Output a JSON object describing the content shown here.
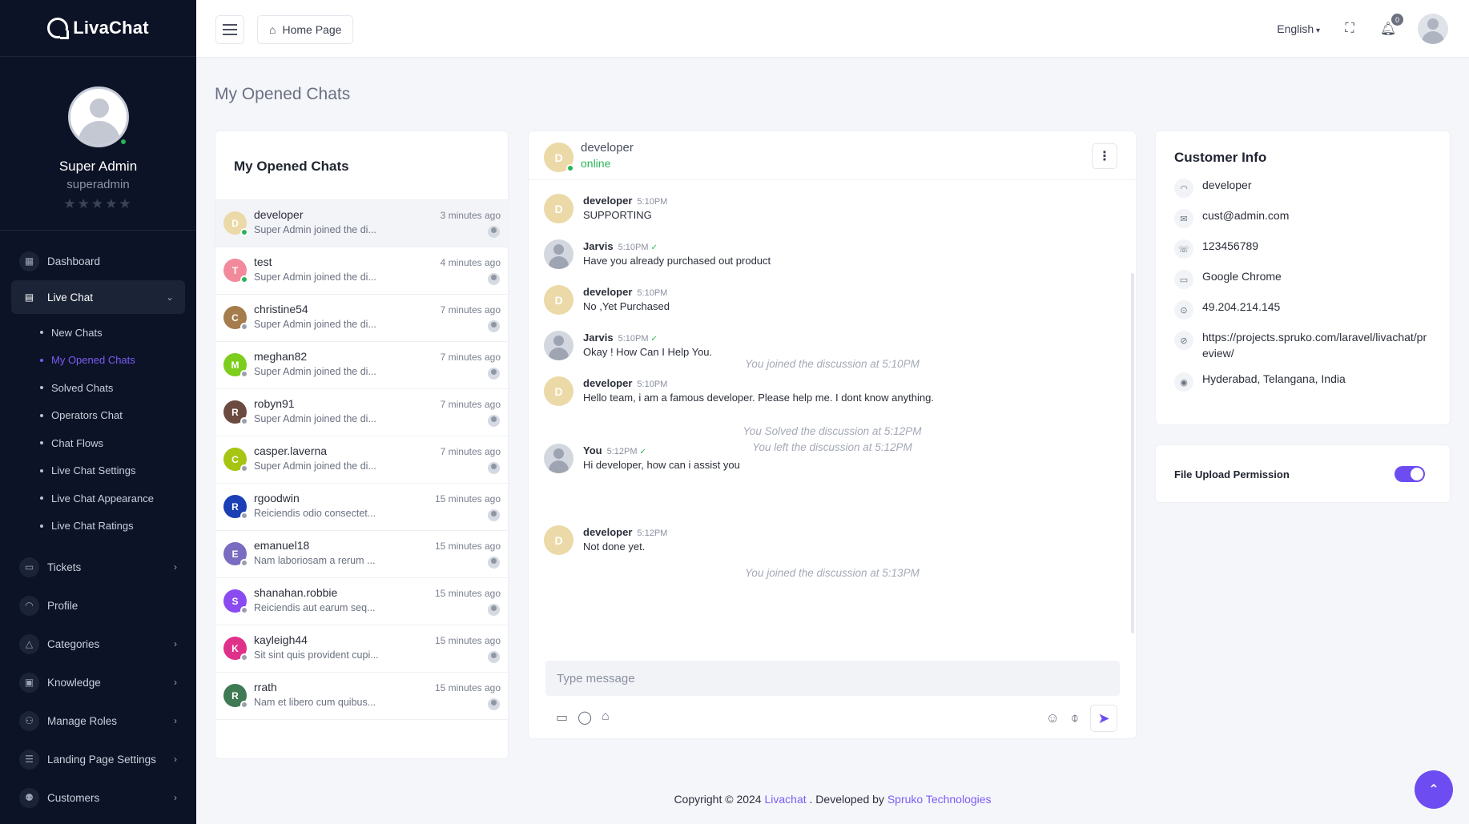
{
  "brand": {
    "name": "LivaChat"
  },
  "user": {
    "name": "Super Admin",
    "role": "superadmin",
    "stars": "★★★★★"
  },
  "nav": {
    "dashboard": "Dashboard",
    "live_chat": "Live Chat",
    "sub": [
      "New Chats",
      "My Opened Chats",
      "Solved Chats",
      "Operators Chat",
      "Chat Flows",
      "Live Chat Settings",
      "Live Chat Appearance",
      "Live Chat Ratings"
    ],
    "tickets": "Tickets",
    "profile": "Profile",
    "categories": "Categories",
    "knowledge": "Knowledge",
    "manage_roles": "Manage Roles",
    "landing": "Landing Page Settings",
    "customers": "Customers"
  },
  "header": {
    "breadcrumb": "Home Page",
    "language": "English",
    "notif_count": "0"
  },
  "page_title": "My Opened Chats",
  "chat_list": {
    "title": "My Opened Chats",
    "rows": [
      {
        "initial": "D",
        "name": "developer",
        "msg": "Super Admin joined the di...",
        "time": "3 minutes ago",
        "color": "#ebd9a8",
        "online": true
      },
      {
        "initial": "T",
        "name": "test",
        "msg": "Super Admin joined the di...",
        "time": "4 minutes ago",
        "color": "#f28a9c",
        "online": true
      },
      {
        "initial": "C",
        "name": "christine54",
        "msg": "Super Admin joined the di...",
        "time": "7 minutes ago",
        "color": "#a57c4b",
        "online": false
      },
      {
        "initial": "M",
        "name": "meghan82",
        "msg": "Super Admin joined the di...",
        "time": "7 minutes ago",
        "color": "#7ccd1c",
        "online": false
      },
      {
        "initial": "R",
        "name": "robyn91",
        "msg": "Super Admin joined the di...",
        "time": "7 minutes ago",
        "color": "#6b4a40",
        "online": false
      },
      {
        "initial": "C",
        "name": "casper.laverna",
        "msg": "Super Admin joined the di...",
        "time": "7 minutes ago",
        "color": "#a6c412",
        "online": false
      },
      {
        "initial": "R",
        "name": "rgoodwin",
        "msg": "Reiciendis odio consectet...",
        "time": "15 minutes ago",
        "color": "#1b3fb5",
        "online": false
      },
      {
        "initial": "E",
        "name": "emanuel18",
        "msg": "Nam laboriosam a rerum ...",
        "time": "15 minutes ago",
        "color": "#7a6cc0",
        "online": false
      },
      {
        "initial": "S",
        "name": "shanahan.robbie",
        "msg": "Reiciendis aut earum seq...",
        "time": "15 minutes ago",
        "color": "#8a4bf0",
        "online": false
      },
      {
        "initial": "K",
        "name": "kayleigh44",
        "msg": "Sit sint quis provident cupi...",
        "time": "15 minutes ago",
        "color": "#e0318a",
        "online": false
      },
      {
        "initial": "R",
        "name": "rrath",
        "msg": "Nam et libero cum quibus...",
        "time": "15 minutes ago",
        "color": "#3f7a55",
        "online": false
      }
    ]
  },
  "conversation": {
    "name": "developer",
    "status": "online",
    "initial": "D",
    "messages": [
      {
        "sender": "developer",
        "time": "5:10PM",
        "text": "SUPPORTING",
        "kind": "d"
      },
      {
        "sender": "Jarvis",
        "time": "5:10PM",
        "text": "Have you already purchased out product",
        "kind": "p"
      },
      {
        "sender": "developer",
        "time": "5:10PM",
        "text": "No ,Yet Purchased",
        "kind": "d"
      },
      {
        "sender": "Jarvis",
        "time": "5:10PM",
        "text": "Okay ! How Can I Help You.",
        "kind": "p"
      },
      {
        "sender": "developer",
        "time": "5:10PM",
        "text": "Hello team, i am a famous developer. Please help me. I dont know anything.",
        "kind": "d"
      },
      {
        "sender": "You",
        "time": "5:12PM",
        "text": "Hi developer, how can i assist you",
        "kind": "p"
      },
      {
        "sender": "developer",
        "time": "5:12PM",
        "text": "Not done yet.",
        "kind": "d"
      }
    ],
    "system": [
      "You joined the discussion at 5:10PM",
      "You Solved the discussion at 5:12PM",
      "You left the discussion at 5:12PM",
      "You joined the discussion at 5:13PM"
    ],
    "placeholder": "Type message"
  },
  "customer": {
    "title": "Customer Info",
    "name": "developer",
    "email": "cust@admin.com",
    "phone": "123456789",
    "browser": "Google Chrome",
    "ip": "49.204.214.145",
    "url": "https://projects.spruko.com/laravel/livachat/preview/",
    "location": "Hyderabad, Telangana, India"
  },
  "permission": {
    "label": "File Upload Permission"
  },
  "footer": {
    "prefix": "Copyright © 2024",
    "brand": "Livachat",
    "middle": ". Developed by",
    "company": "Spruko Technologies"
  }
}
